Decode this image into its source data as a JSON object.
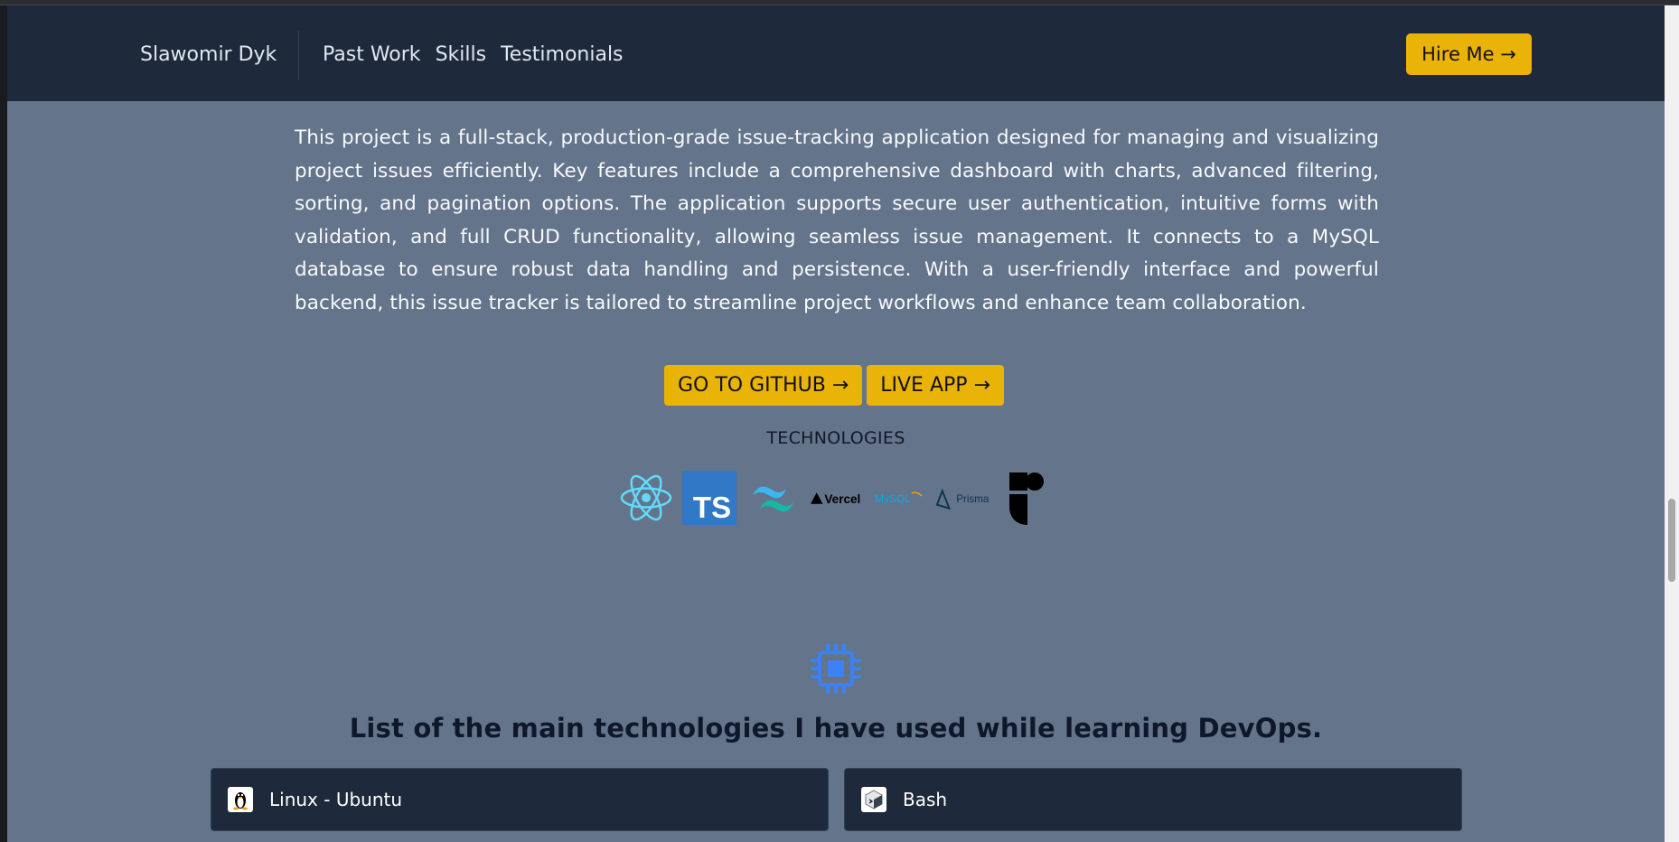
{
  "header": {
    "brand": "Slawomir Dyk",
    "nav": [
      "Past Work",
      "Skills",
      "Testimonials"
    ],
    "hire_label": "Hire Me →"
  },
  "project": {
    "description": "This project is a full-stack, production-grade issue-tracking application designed for managing and visualizing project issues efficiently. Key features include a comprehensive dashboard with charts, advanced filtering, sorting, and pagination options. The application supports secure user authentication, intuitive forms with validation, and full CRUD functionality, allowing seamless issue management. It connects to a MySQL database to ensure robust data handling and persistence. With a user-friendly interface and powerful backend, this issue tracker is tailored to streamline project workflows and enhance team collaboration.",
    "github_label": "GO TO GITHUB →",
    "live_label": "LIVE APP →",
    "tech_heading": "TECHNOLOGIES",
    "tech_logos": [
      {
        "name": "react-logo",
        "text": ""
      },
      {
        "name": "typescript-logo",
        "text": "TS"
      },
      {
        "name": "tailwind-logo",
        "text": ""
      },
      {
        "name": "vercel-logo",
        "text": "Vercel"
      },
      {
        "name": "mysql-logo",
        "text": "MySQL"
      },
      {
        "name": "prisma-logo",
        "text": "Prisma"
      },
      {
        "name": "radix-logo",
        "text": ""
      }
    ]
  },
  "devops": {
    "title": "List of the main technologies I have used while learning DevOps.",
    "cards": [
      {
        "label": "Linux - Ubuntu",
        "icon": "linux-icon"
      },
      {
        "label": "Bash",
        "icon": "bash-icon"
      }
    ]
  },
  "colors": {
    "page_bg": "#64748b",
    "navbar_bg": "#1e293b",
    "accent": "#eab308",
    "card_bg": "#1e293b",
    "icon_blue": "#3b82f6"
  }
}
